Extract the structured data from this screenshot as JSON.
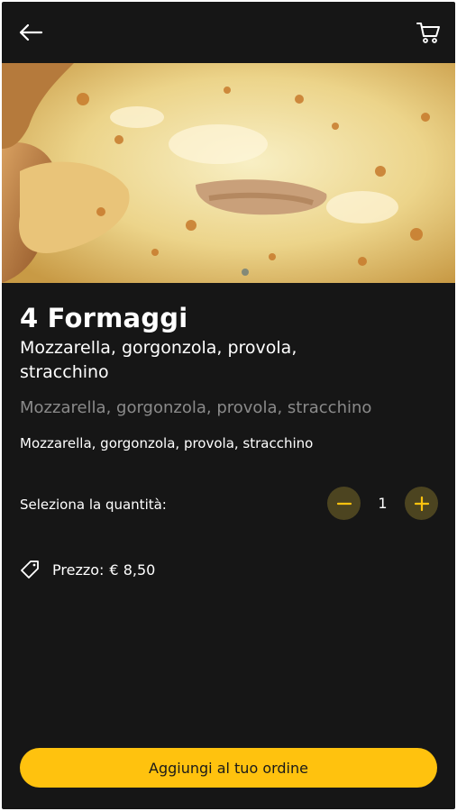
{
  "header": {
    "back_icon": "arrow-left-icon",
    "cart_icon": "shopping-cart-icon"
  },
  "product": {
    "name": "4 Formaggi",
    "subtitle": "Mozzarella, gorgonzola, provola, stracchino",
    "description_muted": "Mozzarella, gorgonzola, provola, stracchino",
    "description": "Mozzarella, gorgonzola, provola, stracchino",
    "image_icon": "pizza-photo"
  },
  "quantity": {
    "label": "Seleziona la quantità:",
    "value": "1",
    "minus_icon": "minus-icon",
    "plus_icon": "plus-icon"
  },
  "price": {
    "icon": "tag-icon",
    "label": "Prezzo:",
    "value": "€ 8,50"
  },
  "cta": {
    "label": "Aggiungi al tuo ordine"
  },
  "colors": {
    "background": "#161616",
    "accent": "#ffc20e",
    "accent_dim": "#4c4420",
    "muted_text": "#8a8a8a"
  }
}
